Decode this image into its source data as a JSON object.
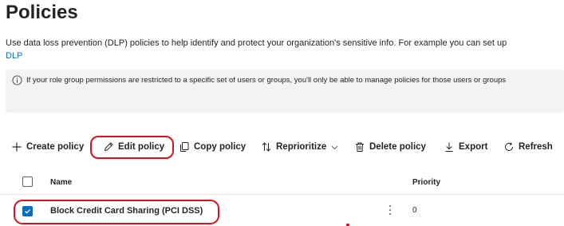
{
  "page": {
    "title": "Policies",
    "description": "Use data loss prevention (DLP) policies to help identify and protect your organization's sensitive info. For example you can set up",
    "description_link": "DLP"
  },
  "info": {
    "icon": "info-icon",
    "text": "If your role group permissions are restricted to a specific set of users or groups, you'll only be able to manage policies for those users or groups"
  },
  "toolbar": {
    "create": {
      "label": "Create policy",
      "icon": "add-icon"
    },
    "edit": {
      "label": "Edit policy",
      "icon": "pencil-icon"
    },
    "copy": {
      "label": "Copy policy",
      "icon": "copy-icon"
    },
    "reprioritize": {
      "label": "Reprioritize",
      "icon": "sort-arrows-icon"
    },
    "delete": {
      "label": "Delete policy",
      "icon": "trash-icon"
    },
    "export": {
      "label": "Export",
      "icon": "download-icon"
    },
    "refresh": {
      "label": "Refresh",
      "icon": "refresh-icon"
    }
  },
  "table": {
    "columns": [
      "Name",
      "Priority"
    ],
    "rows": [
      {
        "name": "Block Credit Card Sharing (PCI DSS)",
        "priority": "0",
        "selected": true
      }
    ]
  },
  "colors": {
    "accent": "#0f6cbd",
    "annotation": "#e30e1a",
    "info_bg": "#f3f3f3"
  }
}
